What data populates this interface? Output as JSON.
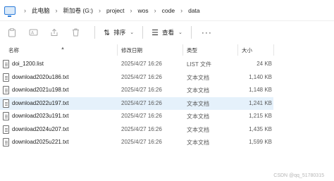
{
  "breadcrumb": {
    "items": [
      "此电脑",
      "新加卷 (G:)",
      "project",
      "wos",
      "code",
      "data"
    ],
    "separator": "›"
  },
  "toolbar": {
    "sort_label": "排序",
    "view_label": "查看",
    "more_label": "···"
  },
  "columns": {
    "name": "名称",
    "modified": "修改日期",
    "type": "类型",
    "size": "大小"
  },
  "files": [
    {
      "name": "doi_1200.list",
      "modified": "2025/4/27 16:26",
      "type": "LIST 文件",
      "size": "24 KB"
    },
    {
      "name": "download2020u186.txt",
      "modified": "2025/4/27 16:26",
      "type": "文本文档",
      "size": "1,140 KB"
    },
    {
      "name": "download2021u198.txt",
      "modified": "2025/4/27 16:26",
      "type": "文本文档",
      "size": "1,148 KB"
    },
    {
      "name": "download2022u197.txt",
      "modified": "2025/4/27 16:26",
      "type": "文本文档",
      "size": "1,241 KB"
    },
    {
      "name": "download2023u191.txt",
      "modified": "2025/4/27 16:26",
      "type": "文本文档",
      "size": "1,215 KB"
    },
    {
      "name": "download2024u207.txt",
      "modified": "2025/4/27 16:26",
      "type": "文本文档",
      "size": "1,435 KB"
    },
    {
      "name": "download2025u221.txt",
      "modified": "2025/4/27 16:26",
      "type": "文本文档",
      "size": "1,599 KB"
    }
  ],
  "selected_row_index": 3,
  "watermark": "CSDN @qq_51780315",
  "colors": {
    "accent": "#2b7bd9",
    "selection": "#e5f1fb"
  }
}
